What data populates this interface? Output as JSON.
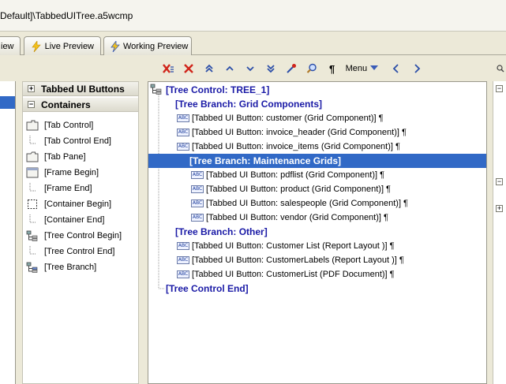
{
  "window": {
    "title": "Default]\\TabbedUITree.a5wcmp"
  },
  "tabs": [
    {
      "label": "iew",
      "icon": "design-view-icon"
    },
    {
      "label": "Live Preview",
      "icon": "lightning-icon"
    },
    {
      "label": "Working Preview",
      "icon": "lightning-blue-icon"
    }
  ],
  "toolbar": {
    "menu_label": "Menu",
    "pilcrow": "¶",
    "icons": [
      "delete-all-icon",
      "delete-icon",
      "move-top-icon",
      "move-up-icon",
      "move-down-icon",
      "move-bottom-icon",
      "edit-wand-icon",
      "find-icon",
      "pilcrow-icon",
      "back-arrow-icon",
      "forward-arrow-icon"
    ]
  },
  "palette": {
    "groups": [
      {
        "label": "Tabbed UI Buttons",
        "expander": "+"
      },
      {
        "label": "Containers",
        "expander": "−"
      }
    ],
    "items": [
      {
        "label": "[Tab Control]",
        "icon": "tab-control-icon"
      },
      {
        "label": "[Tab Control End]",
        "icon": "end-marker-icon"
      },
      {
        "label": "[Tab Pane]",
        "icon": "tab-pane-icon"
      },
      {
        "label": "[Frame Begin]",
        "icon": "frame-icon"
      },
      {
        "label": "[Frame End]",
        "icon": "end-marker-icon"
      },
      {
        "label": "[Container Begin]",
        "icon": "container-icon"
      },
      {
        "label": "[Container End]",
        "icon": "end-marker-icon"
      },
      {
        "label": "[Tree Control Begin]",
        "icon": "tree-control-icon"
      },
      {
        "label": "[Tree Control End]",
        "icon": "end-marker-icon"
      },
      {
        "label": "[Tree Branch]",
        "icon": "tree-branch-icon"
      }
    ]
  },
  "tree": {
    "pilcrow": "¶",
    "rows": [
      {
        "label": "[Tree Control: TREE_1]",
        "kind": "ctl",
        "level": 0,
        "icon": "tree-control-icon"
      },
      {
        "label": "[Tree Branch: Grid Components]",
        "kind": "branch",
        "level": 1
      },
      {
        "label": "[Tabbed UI Button: customer (Grid Component)]",
        "kind": "btn",
        "level": 2
      },
      {
        "label": "[Tabbed UI Button: invoice_header (Grid Component)]",
        "kind": "btn",
        "level": 2
      },
      {
        "label": "[Tabbed UI Button: invoice_items (Grid Component)]",
        "kind": "btn",
        "level": 2
      },
      {
        "label": "[Tree Branch: Maintenance Grids]",
        "kind": "branch",
        "level": 3,
        "selected": true
      },
      {
        "label": "[Tabbed UI Button: pdflist (Grid Component)]",
        "kind": "btn",
        "level": 3
      },
      {
        "label": "[Tabbed UI Button: product (Grid Component)]",
        "kind": "btn",
        "level": 3
      },
      {
        "label": "[Tabbed UI Button: salespeople (Grid Component)]",
        "kind": "btn",
        "level": 3
      },
      {
        "label": "[Tabbed UI Button: vendor (Grid Component)]",
        "kind": "btn",
        "level": 3
      },
      {
        "label": "[Tree Branch: Other]",
        "kind": "branch",
        "level": 1
      },
      {
        "label": "[Tabbed UI Button: Customer List (Report Layout )]",
        "kind": "btn",
        "level": 2
      },
      {
        "label": "[Tabbed UI Button: CustomerLabels (Report Layout )]",
        "kind": "btn",
        "level": 2
      },
      {
        "label": "[Tabbed UI Button: CustomerList (PDF Document)]",
        "kind": "btn",
        "level": 2
      },
      {
        "label": "[Tree Control End]",
        "kind": "ctl",
        "level": 0,
        "icon": "end-marker-icon"
      }
    ]
  },
  "right_panel": {
    "expanders": [
      "−",
      "−",
      "+"
    ]
  }
}
